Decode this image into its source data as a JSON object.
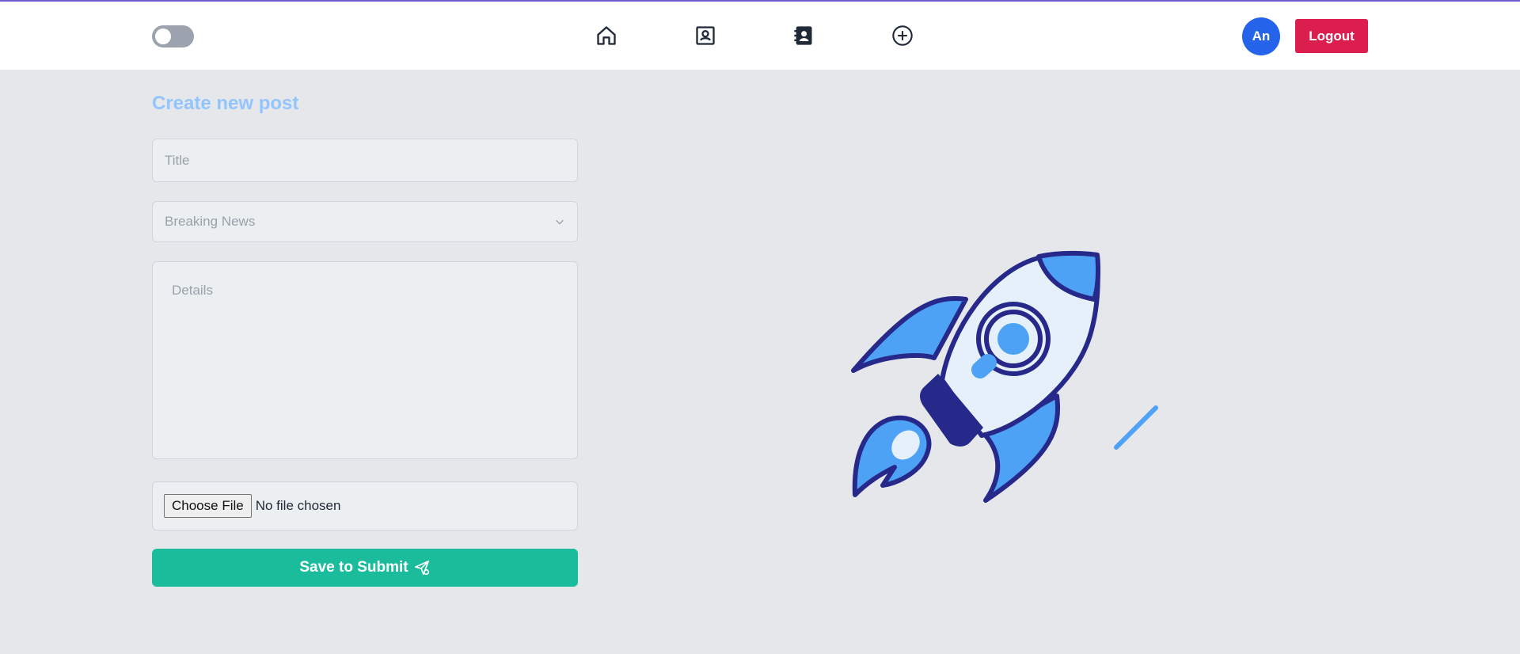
{
  "navbar": {
    "theme_toggle": "theme-toggle",
    "icons": [
      "home-icon",
      "profile-card-icon",
      "contacts-book-icon",
      "add-circle-icon"
    ],
    "avatar_initials": "An",
    "logout_label": "Logout"
  },
  "form": {
    "heading": "Create new post",
    "title_placeholder": "Title",
    "category_selected": "Breaking News",
    "details_placeholder": "Details",
    "file_button_label": "Choose File",
    "file_status": "No file chosen",
    "submit_label": "Save to Submit"
  },
  "colors": {
    "accent_top_line": "#6d5dd3",
    "avatar": "#2563eb",
    "logout": "#dc1e4e",
    "submit": "#1abc9c",
    "heading": "#93c5fd",
    "background": "#e5e7eb"
  },
  "illustration": {
    "icon": "rocket-illustration-icon"
  }
}
